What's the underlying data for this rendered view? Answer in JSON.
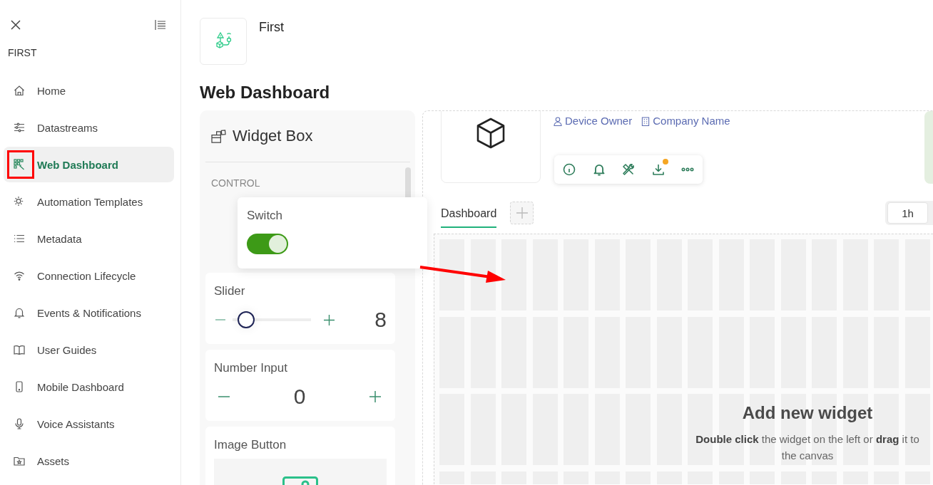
{
  "sidebar": {
    "title": "FIRST",
    "items": [
      {
        "label": "Home",
        "selected": false,
        "highlighted": false
      },
      {
        "label": "Datastreams",
        "selected": false,
        "highlighted": false
      },
      {
        "label": "Web Dashboard",
        "selected": true,
        "highlighted": true
      },
      {
        "label": "Automation Templates",
        "selected": false,
        "highlighted": false
      },
      {
        "label": "Metadata",
        "selected": false,
        "highlighted": false
      },
      {
        "label": "Connection Lifecycle",
        "selected": false,
        "highlighted": false
      },
      {
        "label": "Events & Notifications",
        "selected": false,
        "highlighted": false
      },
      {
        "label": "User Guides",
        "selected": false,
        "highlighted": false
      },
      {
        "label": "Mobile Dashboard",
        "selected": false,
        "highlighted": false
      },
      {
        "label": "Voice Assistants",
        "selected": false,
        "highlighted": false
      },
      {
        "label": "Assets",
        "selected": false,
        "highlighted": false
      }
    ]
  },
  "template": {
    "name": "First",
    "title": "Web Dashboard"
  },
  "widget_box": {
    "title": "Widget Box",
    "section": "CONTROL",
    "widgets": [
      {
        "kind": "switch",
        "label": "Switch",
        "dragging": true,
        "on": true
      },
      {
        "kind": "slider",
        "label": "Slider",
        "dragging": false,
        "level": 0.08,
        "value": "8"
      },
      {
        "kind": "number",
        "label": "Number Input",
        "dragging": false,
        "value": "0"
      },
      {
        "kind": "image_button",
        "label": "Image Button",
        "dragging": false
      }
    ]
  },
  "device": {
    "owner": "Device Owner",
    "company": "Company Name",
    "actions": [
      {
        "badge": false
      },
      {
        "badge": false
      },
      {
        "badge": false
      },
      {
        "badge": true
      },
      {
        "badge": false
      }
    ]
  },
  "tabs": [
    {
      "label": "Dashboard",
      "selected": true
    }
  ],
  "time_ranges": [
    {
      "label": "1h",
      "selected": true
    }
  ],
  "canvas": {
    "title": "Add new widget",
    "hint": "**Double click** the widget on the left or **drag** it to the canvas"
  },
  "annotation_arrow": true
}
